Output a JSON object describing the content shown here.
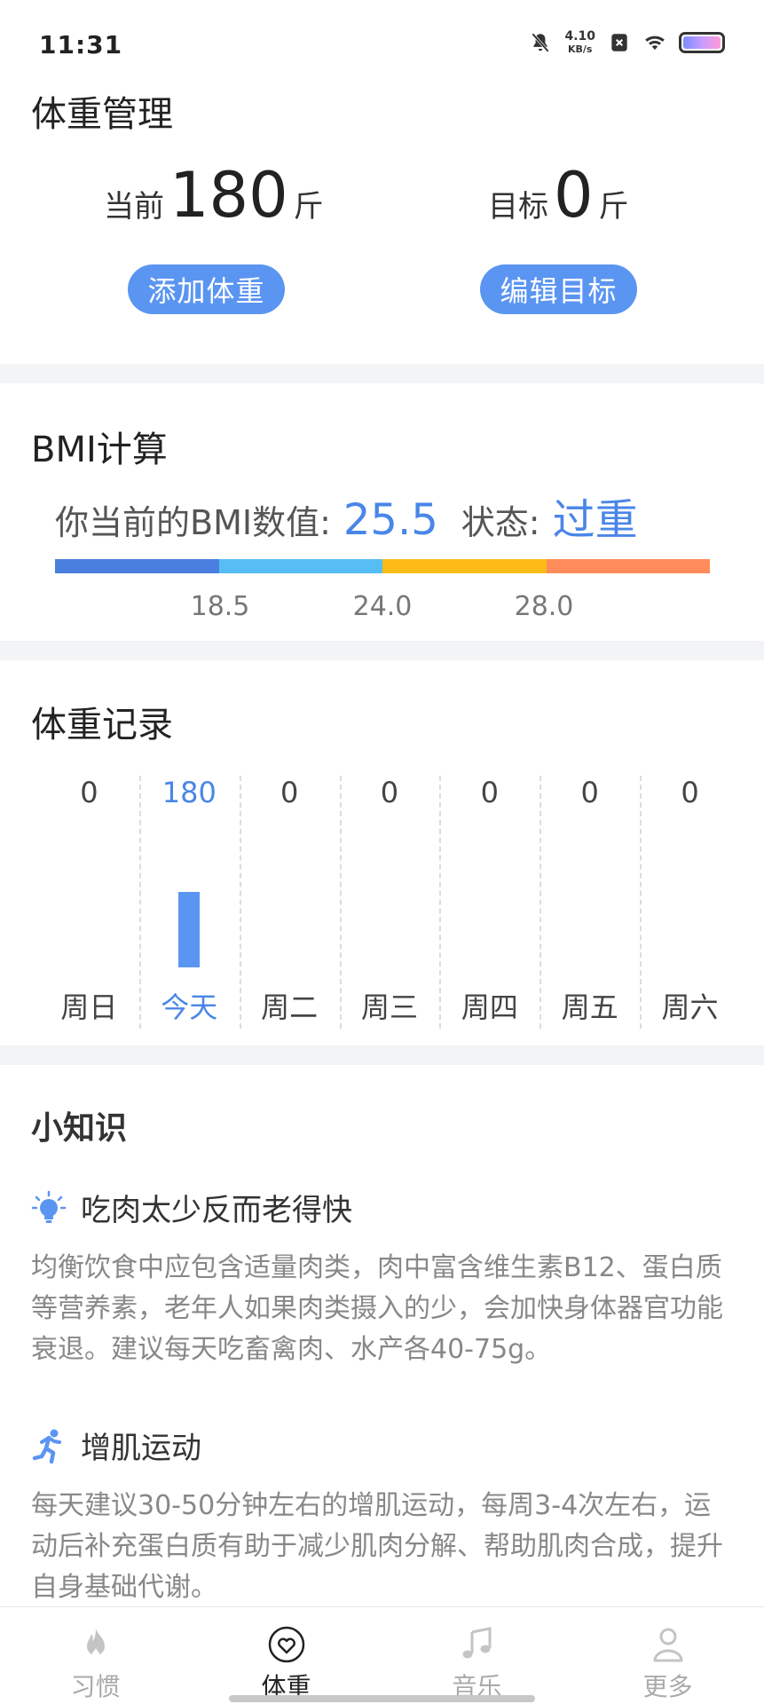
{
  "status_bar": {
    "time": "11:31",
    "net_speed_value": "4.10",
    "net_speed_unit": "KB/s"
  },
  "weight": {
    "title": "体重管理",
    "current_label": "当前",
    "current_value": "180",
    "current_unit": "斤",
    "target_label": "目标",
    "target_value": "0",
    "target_unit": "斤",
    "add_button": "添加体重",
    "edit_button": "编辑目标"
  },
  "bmi": {
    "title": "BMI计算",
    "text": "你当前的BMI数值:",
    "value": "25.5",
    "status_label": "状态:",
    "status": "过重",
    "scale_colors": [
      "#4a7fe0",
      "#57bdf5",
      "#fcbb17",
      "#ff8c5a"
    ],
    "ticks": [
      "18.5",
      "24.0",
      "28.0"
    ]
  },
  "records": {
    "title": "体重记录",
    "chart_data": {
      "type": "bar",
      "categories": [
        "周日",
        "今天",
        "周二",
        "周三",
        "周四",
        "周五",
        "周六"
      ],
      "values": [
        0,
        180,
        0,
        0,
        0,
        0,
        0
      ],
      "highlight_index": 1,
      "ylim": [
        0,
        380
      ]
    },
    "value_labels": [
      "0",
      "180",
      "0",
      "0",
      "0",
      "0",
      "0"
    ]
  },
  "tips": {
    "title": "小知识",
    "items": [
      {
        "icon": "lightbulb-icon",
        "title": "吃肉太少反而老得快",
        "body": "均衡饮食中应包含适量肉类，肉中富含维生素B12、蛋白质等营养素，老年人如果肉类摄入的少，会加快身体器官功能衰退。建议每天吃畜禽肉、水产各40-75g。"
      },
      {
        "icon": "running-icon",
        "title": "增肌运动",
        "body": "每天建议30-50分钟左右的增肌运动，每周3-4次左右，运动后补充蛋白质有助于减少肌肉分解、帮助肌肉合成，提升自身基础代谢。"
      }
    ]
  },
  "nav": {
    "items": [
      {
        "label": "习惯",
        "icon": "flame-icon",
        "active": false
      },
      {
        "label": "体重",
        "icon": "heart-icon",
        "active": true
      },
      {
        "label": "音乐",
        "icon": "music-note-icon",
        "active": false
      },
      {
        "label": "更多",
        "icon": "user-icon",
        "active": false
      }
    ]
  },
  "colors": {
    "accent": "#5b95f2",
    "highlight_text": "#4a86e8"
  }
}
